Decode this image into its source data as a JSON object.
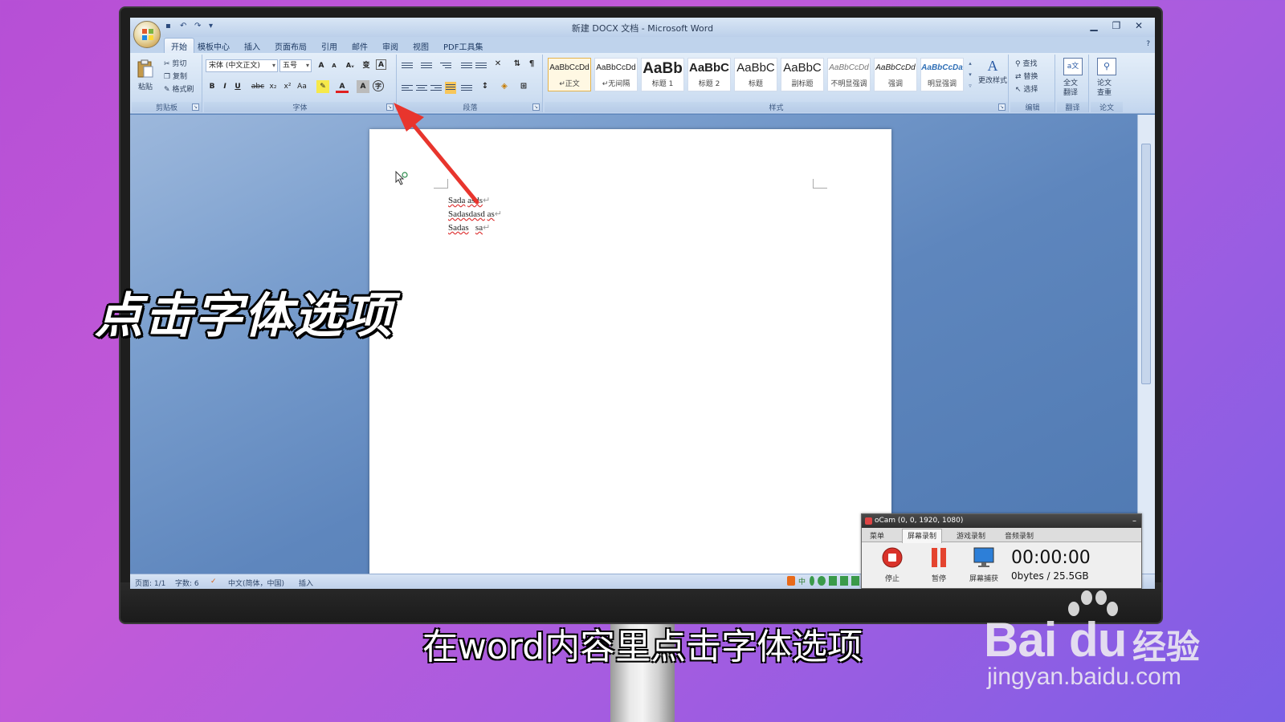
{
  "window": {
    "title": "新建 DOCX 文档 - Microsoft Word"
  },
  "tabs": [
    "开始",
    "模板中心",
    "插入",
    "页面布局",
    "引用",
    "邮件",
    "审阅",
    "视图",
    "PDF工具集"
  ],
  "ribbon": {
    "clipboard": {
      "paste": "粘贴",
      "cut": "剪切",
      "copy": "复制",
      "format_painter": "格式刷",
      "label": "剪贴板"
    },
    "font": {
      "font_name": "宋体 (中文正文)",
      "font_size": "五号",
      "label": "字体",
      "bold": "B",
      "italic": "I",
      "underline": "U",
      "strike": "abc",
      "subscript": "x₂",
      "superscript": "x²",
      "change_case": "Aa",
      "font_color": "A",
      "char_shading": "A",
      "enclose": "字",
      "grow": "A",
      "shrink": "A",
      "clear": "Aᵥ",
      "phonetic": "变",
      "border": "A"
    },
    "paragraph": {
      "label": "段落"
    },
    "styles": {
      "label": "样式",
      "items": [
        {
          "sample": "AaBbCcDd",
          "name": "↵正文"
        },
        {
          "sample": "AaBbCcDd",
          "name": "↵无间隔"
        },
        {
          "sample": "AaBb",
          "name": "标题 1"
        },
        {
          "sample": "AaBbC",
          "name": "标题 2"
        },
        {
          "sample": "AaBbC",
          "name": "标题"
        },
        {
          "sample": "AaBbC",
          "name": "副标题"
        },
        {
          "sample": "AaBbCcDd",
          "name": "不明显强调"
        },
        {
          "sample": "AaBbCcDd",
          "name": "强调"
        },
        {
          "sample": "AaBbCcDa",
          "name": "明显强调"
        }
      ],
      "change_styles": "更改样式"
    },
    "editing": {
      "label": "编辑",
      "find": "查找",
      "replace": "替换",
      "select": "选择"
    },
    "translate": {
      "label": "翻译",
      "full_text": "全文",
      "translate": "翻译"
    },
    "paper": {
      "label": "论文",
      "line1": "论文",
      "line2": "查重"
    }
  },
  "document": {
    "lines": [
      {
        "a": "Sada",
        "b": "asds",
        "mark": "↵"
      },
      {
        "a": "Sadasdasd",
        "b": "as",
        "mark": "↵"
      },
      {
        "a": "Sadas",
        "b": "sa",
        "mark": "↵"
      }
    ]
  },
  "statusbar": {
    "page": "页面: 1/1",
    "words": "字数: 6",
    "language": "中文(简体，中国)",
    "mode": "插入"
  },
  "ocam": {
    "title": "oCam (0, 0, 1920, 1080)",
    "tabs": [
      "菜单",
      "屏幕录制",
      "游戏录制",
      "音频录制"
    ],
    "stop": "停止",
    "pause": "暂停",
    "capture": "屏幕捕获",
    "time": "00:00:00",
    "size": "0bytes / 25.5GB"
  },
  "overlay": {
    "big_caption": "点击字体选项",
    "subtitle": "在word内容里点击字体选项",
    "wm_logo": "Bai du",
    "wm_cn": "经验",
    "wm_url": "jingyan.baidu.com"
  },
  "colors": {
    "background": "#b64fd6",
    "arrow": "#e8352d",
    "word_blue": "#5d86bc"
  }
}
